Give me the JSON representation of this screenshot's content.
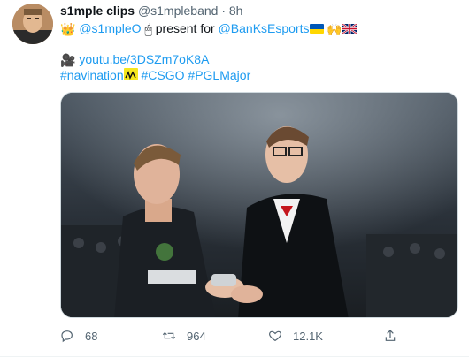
{
  "tweet": {
    "author": {
      "name": "s1mple clips",
      "handle": "@s1mpleband",
      "separator": "·",
      "time": "8h"
    },
    "text": {
      "mention1": "@s1mpleO",
      "word_present": "present for",
      "mention2": "@BanKsEsports",
      "link": "youtu.be/3DSZm7oK8A",
      "hashtag1": "#navination",
      "hashtag2": "#CSGO",
      "hashtag3": "#PGLMajor"
    },
    "emojis": [
      "crown",
      "mouse",
      "flag-ukraine",
      "raising-hands",
      "flag-uk",
      "video-camera",
      "navi-logo"
    ],
    "actions": {
      "replies": "68",
      "retweets": "964",
      "likes": "12.1K"
    },
    "colors": {
      "link": "#1d9bf0",
      "secondary_text": "#536471",
      "ukraine_blue": "#0057b7",
      "ukraine_yellow": "#ffd700",
      "navi_yellow": "#f5e71e"
    }
  }
}
